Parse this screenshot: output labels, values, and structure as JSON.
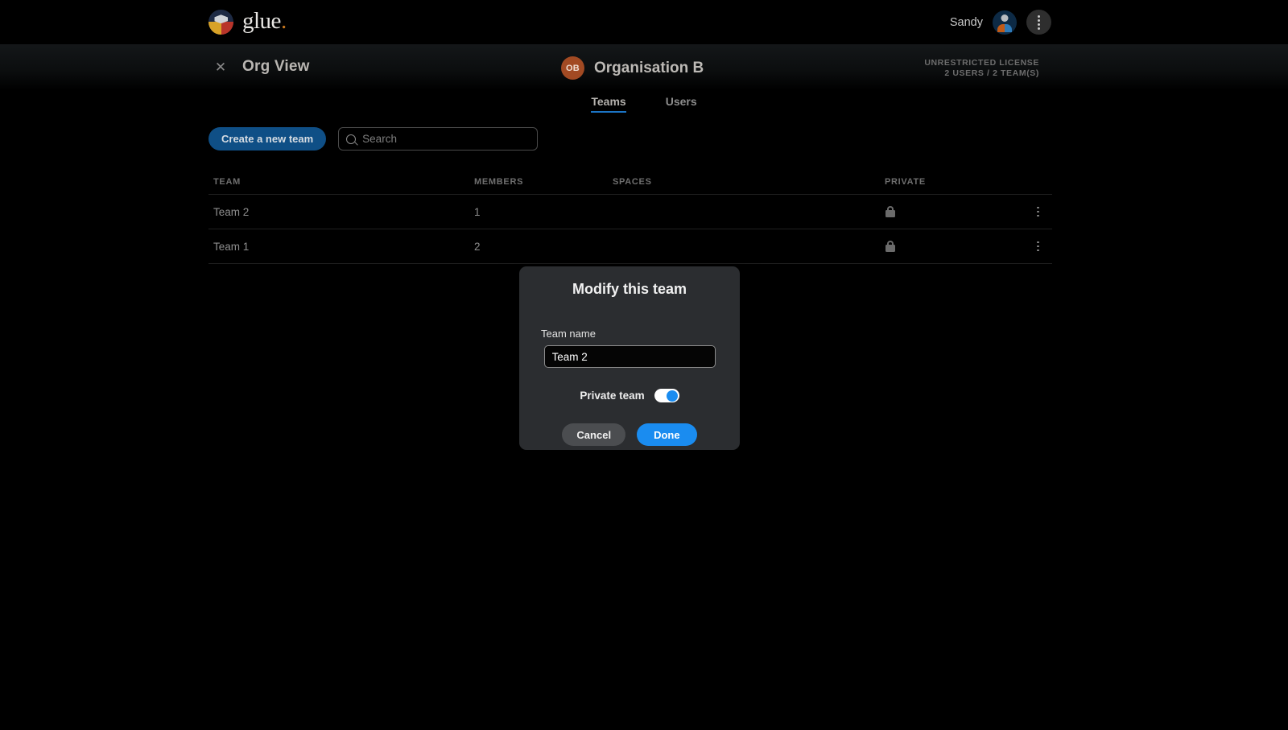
{
  "topbar": {
    "brand_name": "glue",
    "brand_dot": ".",
    "logo_icon": "glue-cube-logo-icon",
    "user_name": "Sandy",
    "avatar_icon": "user-avatar-icon",
    "more_icon": "kebab-menu-icon"
  },
  "orgheader": {
    "close_icon": "close-icon",
    "view_title": "Org View",
    "org_initials": "OB",
    "org_name": "Organisation B",
    "license_line1": "UNRESTRICTED LICENSE",
    "license_line2": "2 USERS / 2 TEAM(S)"
  },
  "tabs": [
    {
      "label": "Teams",
      "active": true
    },
    {
      "label": "Users",
      "active": false
    }
  ],
  "toolbar": {
    "create_label": "Create a new team",
    "search_placeholder": "Search",
    "search_value": "",
    "search_icon": "search-icon"
  },
  "table": {
    "columns": [
      "TEAM",
      "MEMBERS",
      "SPACES",
      "PRIVATE"
    ],
    "rows": [
      {
        "team": "Team 2",
        "members": "1",
        "spaces": "",
        "private_icon": "lock-icon",
        "menu_icon": "kebab-menu-icon"
      },
      {
        "team": "Team 1",
        "members": "2",
        "spaces": "",
        "private_icon": "lock-icon",
        "menu_icon": "kebab-menu-icon"
      }
    ]
  },
  "modal": {
    "title": "Modify this team",
    "field_label": "Team name",
    "field_value": "Team 2",
    "field_placeholder": "Team name",
    "toggle_label": "Private team",
    "toggle_on": true,
    "cancel_label": "Cancel",
    "done_label": "Done"
  },
  "colors": {
    "page_bg": "#000000",
    "accent_blue": "#1a8cf0",
    "tab_underline": "#1b74c4",
    "create_button": "#0f4f86",
    "org_badge": "#a24a23",
    "modal_bg": "#2b2d30",
    "cancel_button": "#4b4d50"
  }
}
